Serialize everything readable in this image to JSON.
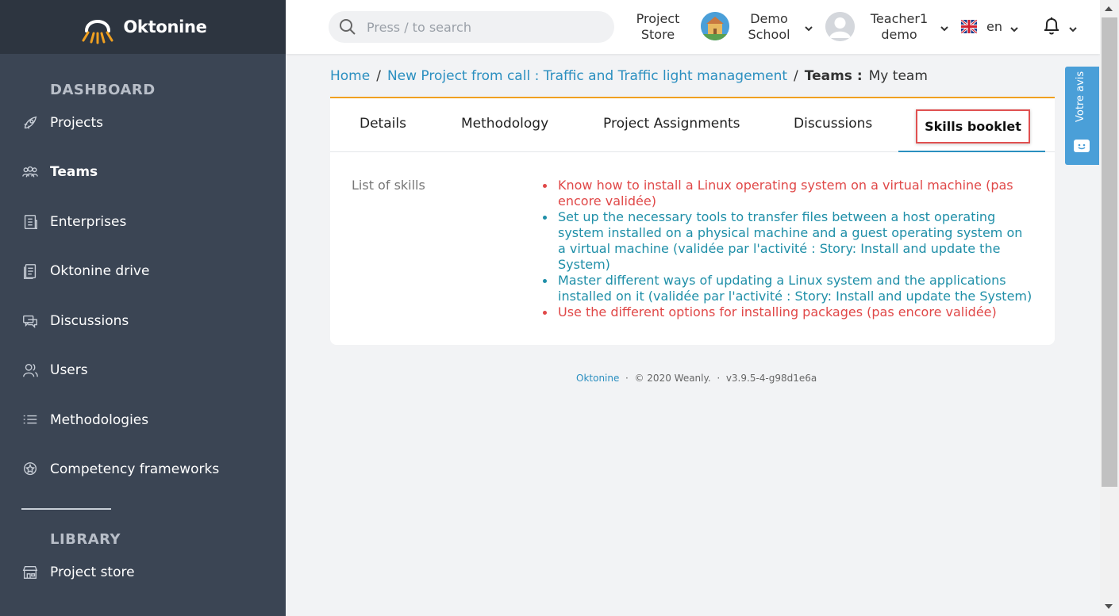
{
  "app": {
    "name": "Oktonine"
  },
  "sidebar": {
    "sections": {
      "dashboard": "DASHBOARD",
      "library": "LIBRARY"
    },
    "items": [
      {
        "label": "Projects",
        "icon": "rocket-icon"
      },
      {
        "label": "Teams",
        "icon": "people-icon"
      },
      {
        "label": "Enterprises",
        "icon": "building-icon"
      },
      {
        "label": "Oktonine drive",
        "icon": "document-icon"
      },
      {
        "label": "Discussions",
        "icon": "chat-icon"
      },
      {
        "label": "Users",
        "icon": "users-icon"
      },
      {
        "label": "Methodologies",
        "icon": "list-icon"
      },
      {
        "label": "Competency frameworks",
        "icon": "badge-icon"
      }
    ],
    "library_items": [
      {
        "label": "Project store",
        "icon": "store-icon"
      }
    ],
    "active": "Teams"
  },
  "header": {
    "search_placeholder": "Press / to search",
    "project_store_line1": "Project",
    "project_store_line2": "Store",
    "school_line1": "Demo",
    "school_line2": "School",
    "user_line1": "Teacher1",
    "user_line2": "demo",
    "language": "en"
  },
  "feedback": {
    "label": "Votre avis"
  },
  "breadcrumb": {
    "home": "Home",
    "sep": "/",
    "project": "New Project from call : Traffic and Traffic light management",
    "teams_label": "Teams :",
    "current": "My team"
  },
  "tabs": [
    {
      "label": "Details"
    },
    {
      "label": "Methodology"
    },
    {
      "label": "Project Assignments"
    },
    {
      "label": "Discussions"
    },
    {
      "label": "Skills booklet"
    }
  ],
  "skills": {
    "label": "List of skills",
    "items": [
      {
        "text": "Know how to install a Linux operating system on a virtual machine (pas encore validée)",
        "status": "red"
      },
      {
        "text": "Set up the necessary tools to transfer files between a host operating system installed on a physical machine and a guest operating system on a virtual machine (validée par l'activité : Story: Install and update the System)",
        "status": "teal"
      },
      {
        "text": "Master different ways of updating a Linux system and the applications installed on it (validée par l'activité : Story: Install and update the System)",
        "status": "teal"
      },
      {
        "text": "Use the different options for installing packages (pas encore validée)",
        "status": "red"
      }
    ]
  },
  "footer": {
    "brand": "Oktonine",
    "dot": "·",
    "copyright": "© 2020 Weanly.",
    "version": "v3.9.5-4-g98d1e6a"
  },
  "colors": {
    "sidebar": "#3b4554",
    "brand_bar": "#2d3540",
    "accent": "#2b8fc0",
    "tab_top_border": "#f0a020",
    "not_validated": "#e04848",
    "validated": "#1f8fa8"
  }
}
